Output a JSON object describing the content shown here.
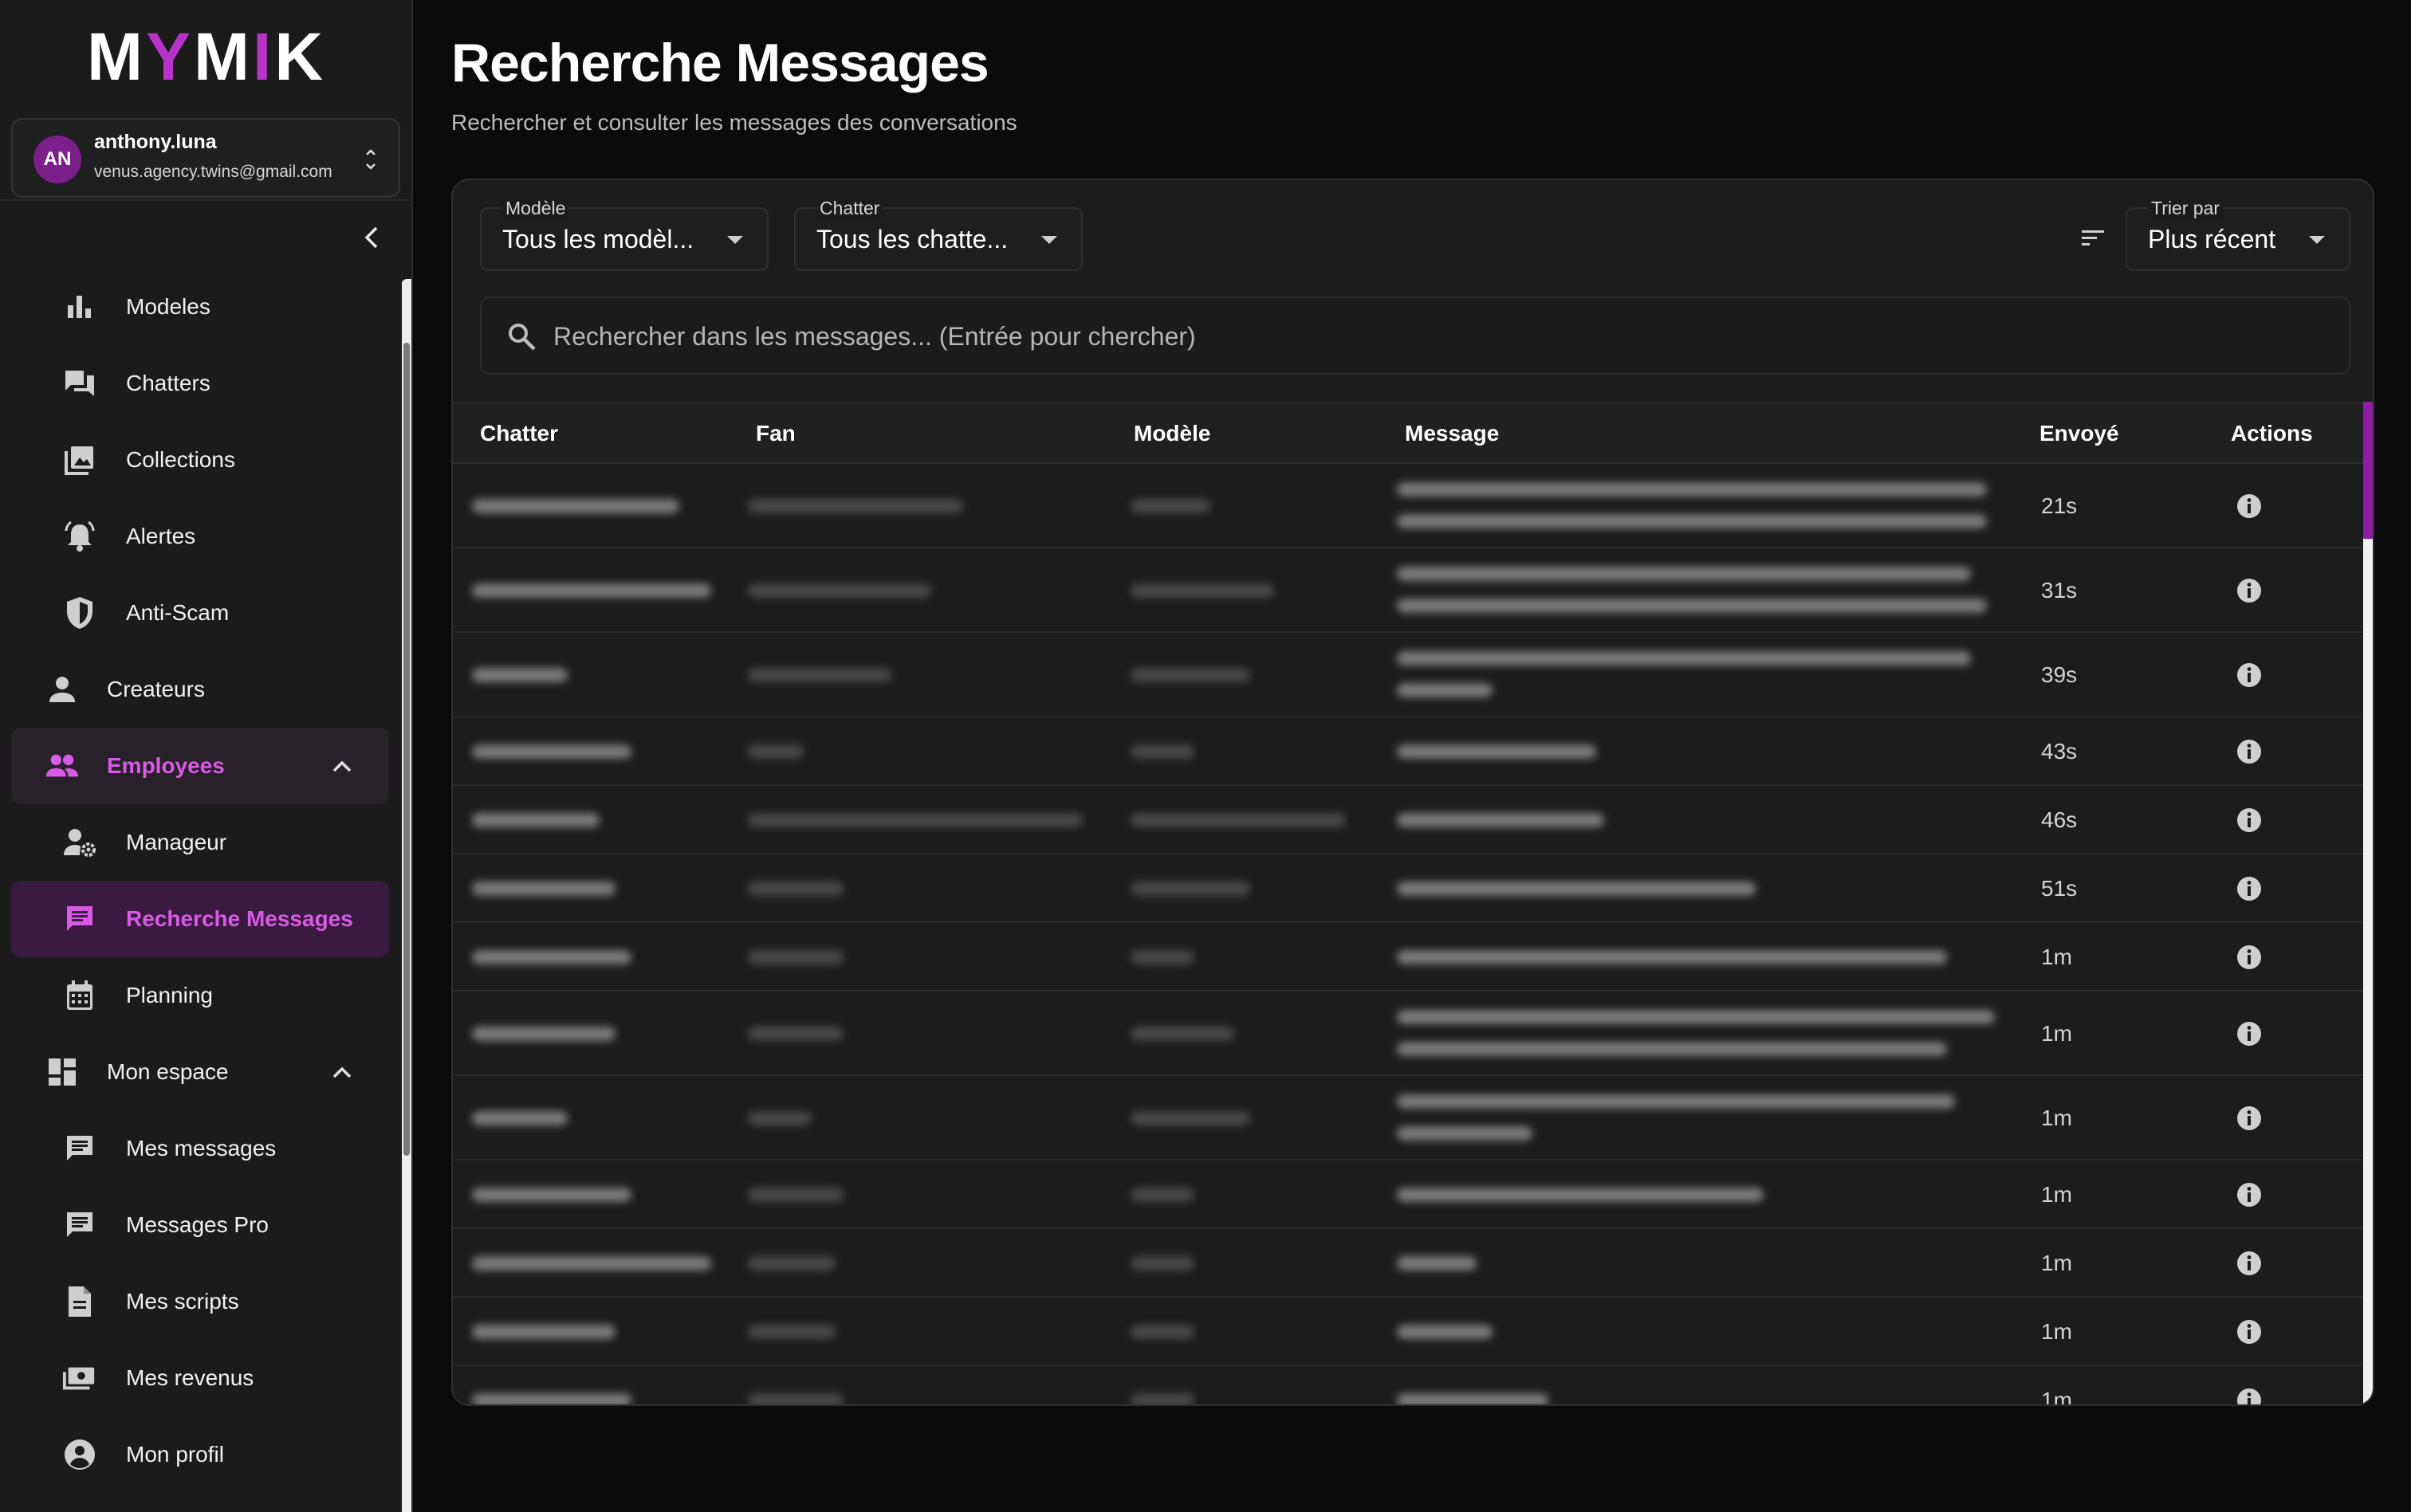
{
  "brand": {
    "logo_pre": "M",
    "logo_y": "Y",
    "logo_m": "M",
    "logo_i": "I",
    "logo_k": "K"
  },
  "account": {
    "initials": "AN",
    "name": "anthony.luna",
    "email": "venus.agency.twins@gmail.com"
  },
  "sidebar": {
    "items": [
      {
        "label": "Modeles",
        "icon": "bar-chart-icon"
      },
      {
        "label": "Chatters",
        "icon": "forum-icon"
      },
      {
        "label": "Collections",
        "icon": "photo-library-icon"
      },
      {
        "label": "Alertes",
        "icon": "alarm-bell-icon"
      },
      {
        "label": "Anti-Scam",
        "icon": "shield-icon"
      },
      {
        "label": "Createurs",
        "icon": "person-icon"
      },
      {
        "label": "Employees",
        "icon": "group-icon"
      },
      {
        "label": "Manageur",
        "icon": "manage-accounts-icon"
      },
      {
        "label": "Recherche Messages",
        "icon": "message-icon"
      },
      {
        "label": "Planning",
        "icon": "calendar-icon"
      },
      {
        "label": "Mon espace",
        "icon": "dashboard-icon"
      },
      {
        "label": "Mes messages",
        "icon": "message-icon"
      },
      {
        "label": "Messages Pro",
        "icon": "message-icon"
      },
      {
        "label": "Mes scripts",
        "icon": "document-icon"
      },
      {
        "label": "Mes revenus",
        "icon": "payments-icon"
      },
      {
        "label": "Mon profil",
        "icon": "account-circle-icon"
      }
    ]
  },
  "header": {
    "title": "Recherche Messages",
    "subtitle": "Rechercher et consulter les messages des conversations"
  },
  "filters": {
    "model": {
      "caption": "Modèle",
      "value": "Tous les modèl..."
    },
    "chatter": {
      "caption": "Chatter",
      "value": "Tous les chatte..."
    },
    "sort": {
      "caption": "Trier par",
      "value": "Plus récent"
    }
  },
  "search": {
    "placeholder": "Rechercher dans les messages... (Entrée pour chercher)"
  },
  "table": {
    "columns": [
      "Chatter",
      "Fan",
      "Modèle",
      "Message",
      "Envoyé",
      "Actions"
    ],
    "rows": [
      {
        "sent": "21s"
      },
      {
        "sent": "31s"
      },
      {
        "sent": "39s"
      },
      {
        "sent": "43s"
      },
      {
        "sent": "46s"
      },
      {
        "sent": "51s"
      },
      {
        "sent": "1m"
      },
      {
        "sent": "1m"
      },
      {
        "sent": "1m"
      },
      {
        "sent": "1m"
      },
      {
        "sent": "1m"
      },
      {
        "sent": "1m"
      },
      {
        "sent": "1m"
      }
    ]
  },
  "colors": {
    "accent": "#b834c9",
    "active_bg": "#3a1a40",
    "background": "#0b0b0b",
    "sidebar": "#1b1b1b"
  }
}
